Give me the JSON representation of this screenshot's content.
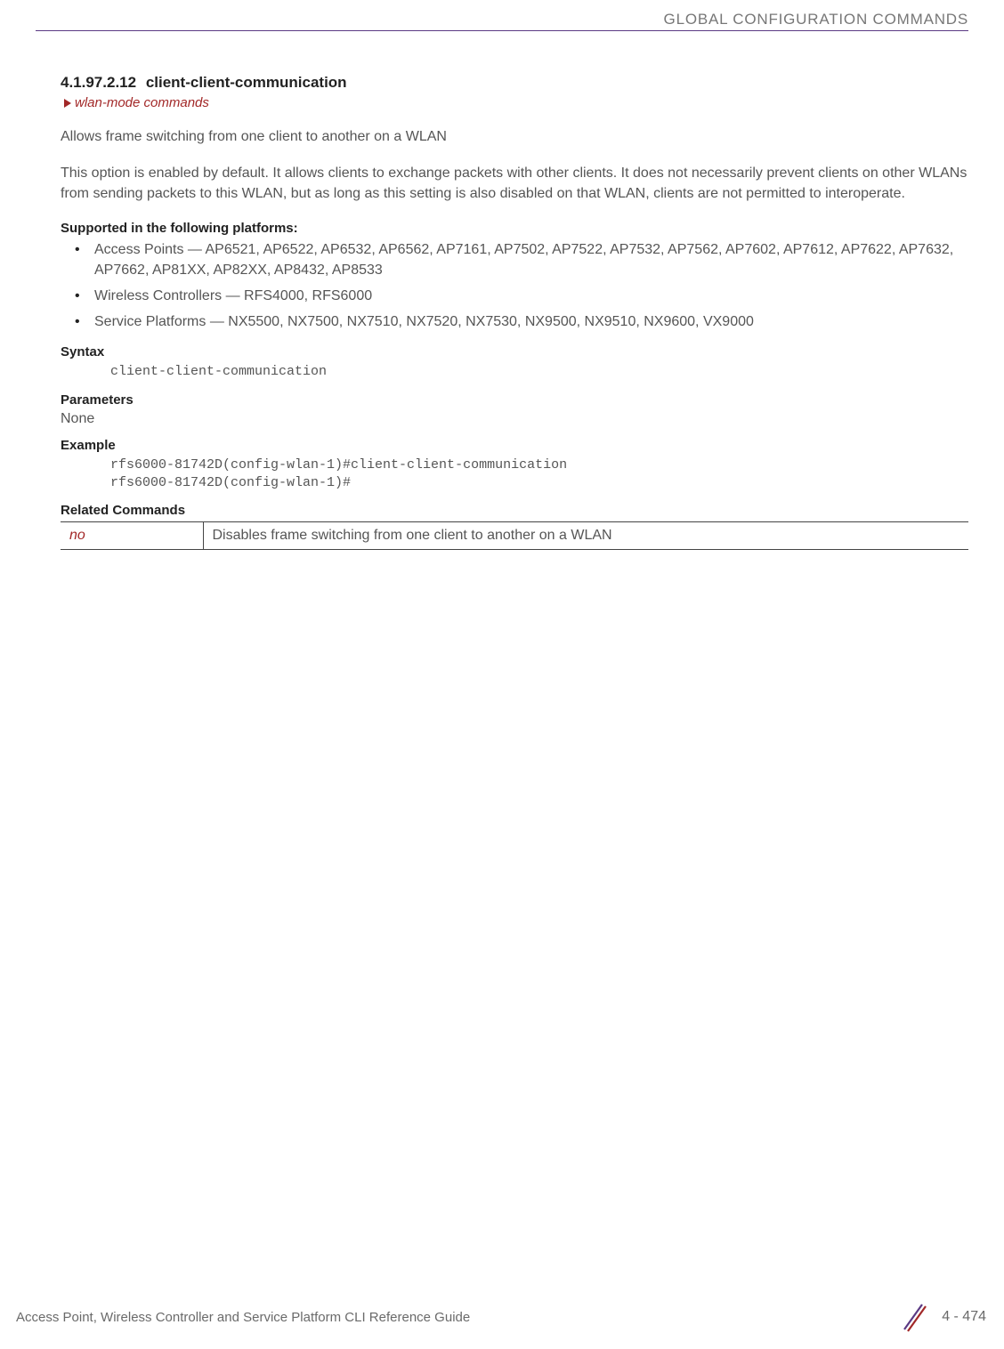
{
  "header": {
    "category": "GLOBAL CONFIGURATION COMMANDS"
  },
  "section": {
    "number": "4.1.97.2.12",
    "title": "client-client-communication",
    "breadcrumb": "wlan-mode commands"
  },
  "intro": "Allows frame switching from one client to another on a WLAN",
  "description": "This option is enabled by default. It allows clients to exchange packets with other clients. It does not necessarily prevent clients on other WLANs from sending packets to this WLAN, but as long as this setting is also disabled on that WLAN, clients are not permitted to interoperate.",
  "supported": {
    "heading": "Supported in the following platforms:",
    "rows": [
      "Access Points — AP6521, AP6522, AP6532, AP6562, AP7161, AP7502, AP7522, AP7532, AP7562, AP7602, AP7612, AP7622, AP7632, AP7662, AP81XX, AP82XX, AP8432, AP8533",
      "Wireless Controllers — RFS4000, RFS6000",
      "Service Platforms — NX5500, NX7500, NX7510, NX7520, NX7530, NX9500, NX9510, NX9600, VX9000"
    ]
  },
  "syntax": {
    "heading": "Syntax",
    "code": "client-client-communication"
  },
  "parameters": {
    "heading": "Parameters",
    "value": "None"
  },
  "example": {
    "heading": "Example",
    "code": "rfs6000-81742D(config-wlan-1)#client-client-communication\nrfs6000-81742D(config-wlan-1)#"
  },
  "related": {
    "heading": "Related Commands",
    "rows": [
      {
        "cmd": "no",
        "desc": "Disables frame switching from one client to another on a WLAN"
      }
    ]
  },
  "footer": {
    "guide": "Access Point, Wireless Controller and Service Platform CLI Reference Guide",
    "page": "4 - 474"
  }
}
